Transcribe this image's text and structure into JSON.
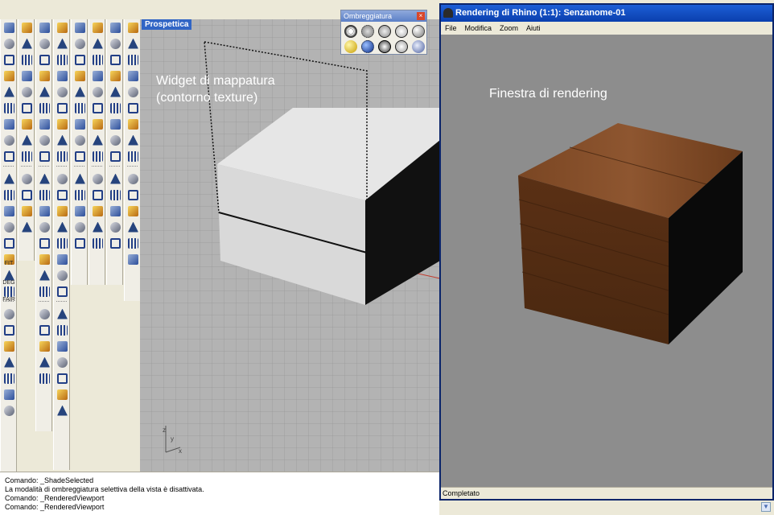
{
  "viewport": {
    "title": "Prospettica",
    "annotation_line1": "Widget di mappatura",
    "annotation_line2": "(contorno texture)",
    "axis_y": "y",
    "axis_z": "z",
    "axis_x": "x"
  },
  "shading_toolbar": {
    "title": "Ombreggiatura",
    "close": "×"
  },
  "render_window": {
    "title": "Rendering di Rhino (1:1): Senzanome-01",
    "menu": [
      "File",
      "Modifica",
      "Zoom",
      "Aiuti"
    ],
    "annotation": "Finestra di rendering",
    "status": "Completato"
  },
  "left_toolbar_text": [
    "FIT",
    "DEG",
    "FAIR"
  ],
  "command_history": [
    "Comando: _ShadeSelected",
    "La modalità di ombreggiatura selettiva della vista è disattivata.",
    "Comando: _RenderedViewport",
    "Comando: _RenderedViewport"
  ],
  "colors": {
    "viewport_bg": "#b3b3b3",
    "render_bg": "#8d8d8d",
    "wood": "#6b3d1e",
    "title_blue": "#0a3fae"
  }
}
